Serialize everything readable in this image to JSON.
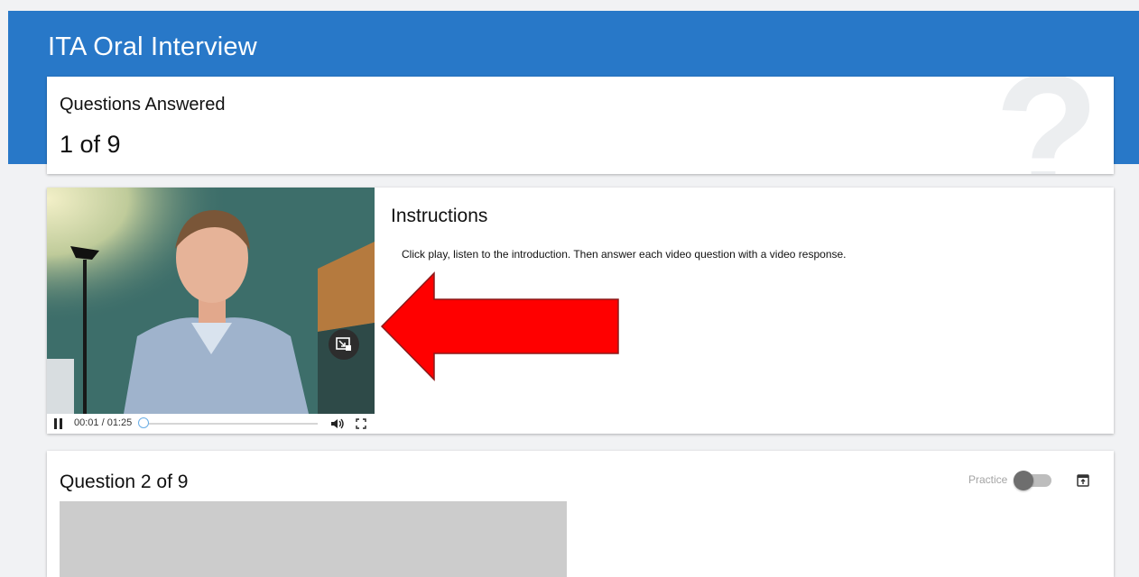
{
  "app": {
    "title": "ITA Oral Interview"
  },
  "progress": {
    "label": "Questions Answered",
    "value": "1 of 9",
    "answered": 1,
    "total": 9,
    "icon": "question-mark-icon"
  },
  "intro": {
    "title": "Instructions",
    "text": "Click play, listen to the introduction. Then answer each video question with a video response.",
    "video": {
      "time": "00:01 / 01:25",
      "played_fraction": 0.01,
      "icons": [
        "pause-icon",
        "volume-icon",
        "fullscreen-icon",
        "picture-in-picture-icon"
      ]
    },
    "annotation": {
      "icon": "arrow-left-icon",
      "color": "#ff0000"
    }
  },
  "question": {
    "title": "Question 2 of 9",
    "practice_label": "Practice",
    "practice_on": false,
    "icon": "popout-icon"
  },
  "colors": {
    "header": "#2878c8",
    "background": "#f1f2f4",
    "card": "#ffffff",
    "arrow": "#ff0000"
  }
}
